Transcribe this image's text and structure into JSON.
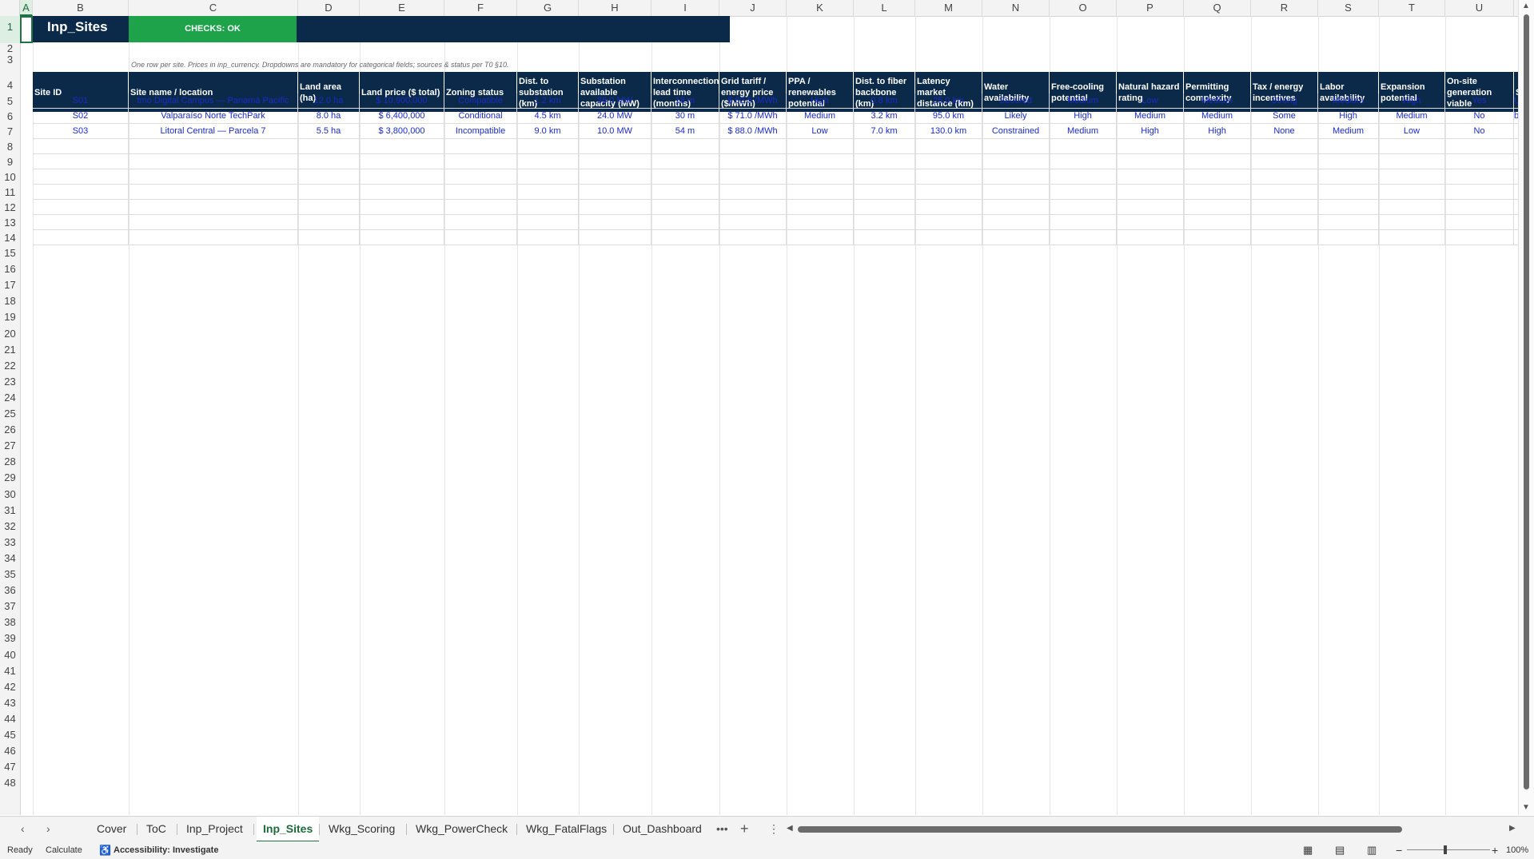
{
  "sheet": {
    "title": "Inp_Sites",
    "checks_label": "CHECKS: OK",
    "note": "One row per site. Prices in inp_currency. Dropdowns are mandatory for categorical fields; sources & status per T0 §10."
  },
  "column_letters": [
    "A",
    "B",
    "C",
    "D",
    "E",
    "F",
    "G",
    "H",
    "I",
    "J",
    "K",
    "L",
    "M",
    "N",
    "O",
    "P",
    "Q",
    "R",
    "S",
    "T",
    "U"
  ],
  "row_numbers": [
    "1",
    "2",
    "3",
    "4",
    "5",
    "6",
    "7",
    "8",
    "9",
    "10",
    "11",
    "12",
    "13",
    "14",
    "15",
    "16",
    "17",
    "18",
    "19",
    "20",
    "21",
    "22",
    "23",
    "24",
    "25",
    "26",
    "27",
    "28",
    "29",
    "30",
    "31",
    "32",
    "33",
    "34",
    "35",
    "36",
    "37",
    "38",
    "39",
    "40",
    "41",
    "42",
    "43",
    "44",
    "45",
    "46",
    "47",
    "48"
  ],
  "table": {
    "headers": [
      "Site ID",
      "Site name / location",
      "Land area (ha)",
      "Land price ($ total)",
      "Zoning status",
      "Dist. to substation (km)",
      "Substation available capacity (MW)",
      "Interconnection lead time (months)",
      "Grid tariff / energy price ($/MWh)",
      "PPA / renewables potential",
      "Dist. to fiber backbone (km)",
      "Latency market distance (km)",
      "Water availability",
      "Free-cooling potential",
      "Natural hazard rating",
      "Permitting complexity",
      "Tax / energy incentives",
      "Labor availability",
      "Expansion potential",
      "On-site generation viable"
    ],
    "rows": [
      [
        "S01",
        "tmo Digital Campus — Panamá Pacífic",
        "12.0 ha",
        "$ 10,900,000",
        "Compatible",
        "1.2 km",
        "36.0 MW",
        "18 m",
        "$ 62.5 /MWh",
        "High",
        "0.8 km",
        "25.0 km",
        "Secured",
        "Medium",
        "Low",
        "Medium",
        "Strong",
        "Medium",
        "High",
        "Yes"
      ],
      [
        "S02",
        "Valparaíso Norte TechPark",
        "8.0 ha",
        "$ 6,400,000",
        "Conditional",
        "4.5 km",
        "24.0 MW",
        "30 m",
        "$ 71.0 /MWh",
        "Medium",
        "3.2 km",
        "95.0 km",
        "Likely",
        "High",
        "Medium",
        "Medium",
        "Some",
        "High",
        "Medium",
        "No"
      ],
      [
        "S03",
        "Litoral Central — Parcela 7",
        "5.5 ha",
        "$ 3,800,000",
        "Incompatible",
        "9.0 km",
        "10.0 MW",
        "54 m",
        "$ 88.0 /MWh",
        "Low",
        "7.0 km",
        "130.0 km",
        "Constrained",
        "Medium",
        "High",
        "High",
        "None",
        "Medium",
        "Low",
        "No"
      ]
    ],
    "partial_header": "S",
    "partial_cells": [
      "U",
      "bl",
      ""
    ]
  },
  "tabs": [
    "Cover",
    "ToC",
    "Inp_Project",
    "Inp_Sites",
    "Wkg_Scoring",
    "Wkg_PowerCheck",
    "Wkg_FatalFlags",
    "Out_Dashboard"
  ],
  "active_tab": "Inp_Sites",
  "tab_controls": {
    "more": "•••",
    "add": "+",
    "options": "⋮",
    "prev": "‹",
    "next": "›"
  },
  "status": {
    "ready": "Ready",
    "calculate": "Calculate",
    "accessibility": "Accessibility: Investigate",
    "zoom": "100%"
  },
  "colors": {
    "header_navy": "#0b2a4a",
    "checks_green": "#1ea34a",
    "data_blue": "#1a2bc9",
    "excel_green": "#217346"
  }
}
